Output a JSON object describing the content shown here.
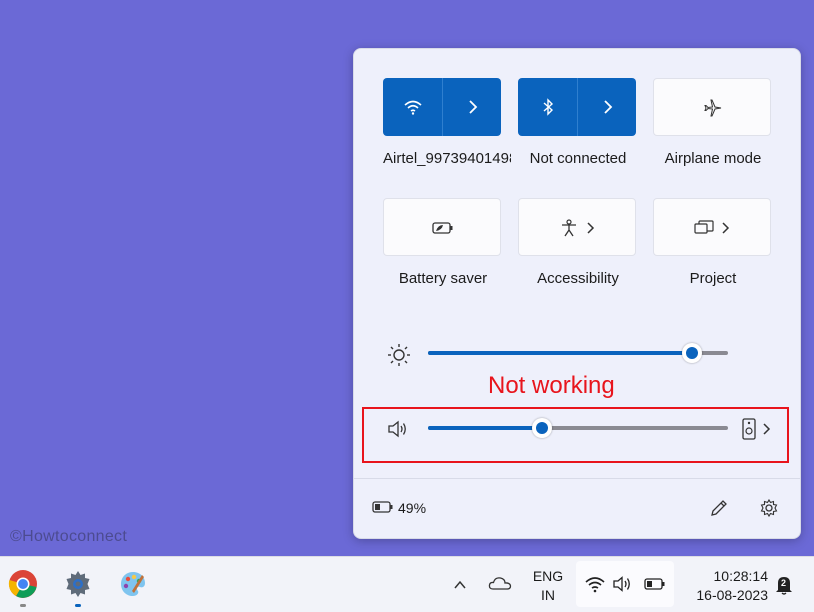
{
  "watermark": "©Howtoconnect",
  "quick_settings": {
    "tiles": [
      {
        "label": "Airtel_99739401498",
        "state": "on",
        "icon": "wifi-icon",
        "has_chevron": true
      },
      {
        "label": "Not connected",
        "state": "on",
        "icon": "bluetooth-icon",
        "has_chevron": true
      },
      {
        "label": "Airplane mode",
        "state": "off",
        "icon": "airplane-icon",
        "has_chevron": false
      },
      {
        "label": "Battery saver",
        "state": "off",
        "icon": "battery-saver-icon",
        "has_chevron": false
      },
      {
        "label": "Accessibility",
        "state": "off",
        "icon": "accessibility-icon",
        "has_chevron": true
      },
      {
        "label": "Project",
        "state": "off",
        "icon": "project-icon",
        "has_chevron": true
      }
    ],
    "brightness": {
      "icon": "sun-icon",
      "value_fraction": 0.88
    },
    "volume": {
      "icon": "speaker-icon",
      "value_fraction": 0.38,
      "output_icon": "speaker-device-icon"
    },
    "battery_percent": "49%",
    "edit_icon": "pencil-icon",
    "settings_icon": "gear-icon"
  },
  "annotation": {
    "text": "Not working",
    "color": "#e8141c"
  },
  "taskbar": {
    "apps": [
      {
        "name": "chrome-icon"
      },
      {
        "name": "settings-app-icon"
      },
      {
        "name": "paint-icon"
      }
    ],
    "language_line1": "ENG",
    "language_line2": "IN",
    "time": "10:28:14",
    "date": "16-08-2023",
    "notification_count": "2"
  },
  "colors": {
    "accent": "#0a63bd",
    "desktop": "#6b69d6",
    "annotation": "#e8141c"
  }
}
